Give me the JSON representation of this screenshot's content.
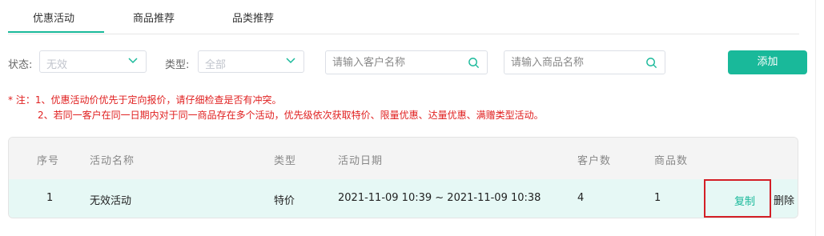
{
  "tabs": [
    {
      "label": "优惠活动",
      "active": true
    },
    {
      "label": "商品推荐",
      "active": false
    },
    {
      "label": "品类推荐",
      "active": false
    }
  ],
  "filters": {
    "status_label": "状态:",
    "status_value": "无效",
    "type_label": "类型:",
    "type_value": "全部",
    "customer_placeholder": "请输入客户名称",
    "product_placeholder": "请输入商品名称",
    "add_label": "添加"
  },
  "notes": {
    "line1": "* 注：1、优惠活动价优先于定向报价，请仔细检查是否有冲突。",
    "line2": "2、若同一客户在同一日期内对于同一商品存在多个活动，优先级依次获取特价、限量优惠、达量优惠、满赠类型活动。"
  },
  "table": {
    "headers": [
      "序号",
      "活动名称",
      "类型",
      "活动日期",
      "客户数",
      "商品数"
    ],
    "rows": [
      {
        "index": "1",
        "name": "无效活动",
        "type": "特价",
        "date": "2021-11-09 10:39 ~ 2021-11-09 10:38",
        "customers": "4",
        "products": "1",
        "copy": "复制",
        "delete": "删除"
      }
    ]
  },
  "colors": {
    "accent": "#19b99a",
    "warning": "#e02020",
    "highlight_box": "#d31f26",
    "row_bg": "#e6f8f5"
  }
}
